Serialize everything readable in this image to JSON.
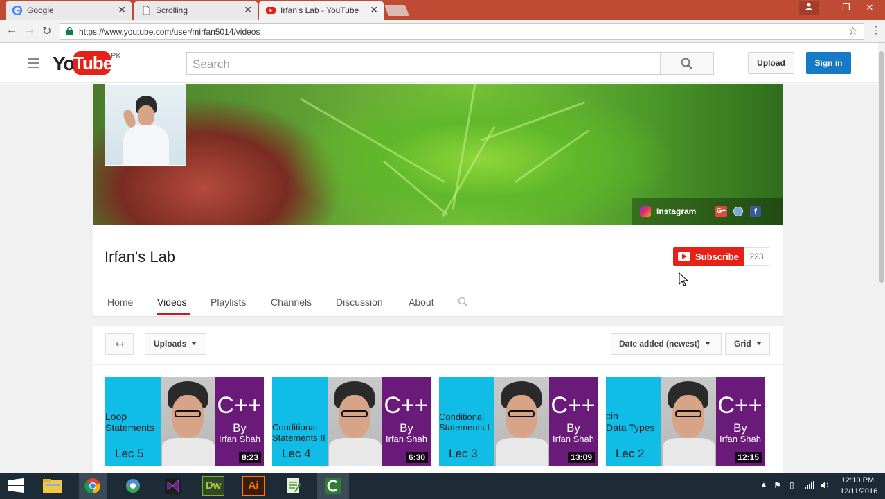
{
  "browser": {
    "tabs": [
      {
        "title": "Google",
        "icon": "google-icon"
      },
      {
        "title": "Scrolling",
        "icon": "page-icon"
      },
      {
        "title": "Irfan's Lab - YouTube",
        "icon": "youtube-icon"
      }
    ],
    "url": "https://www.youtube.com/user/mirfan5014/videos"
  },
  "yt_header": {
    "logo_you": "You",
    "logo_tube": "Tube",
    "region": "PK",
    "search_placeholder": "Search",
    "upload_label": "Upload",
    "signin_label": "Sign in"
  },
  "banner": {
    "links": {
      "instagram_label": "Instagram",
      "gplus_label": "G+",
      "facebook_label": "f"
    }
  },
  "channel": {
    "name": "Irfan's Lab",
    "subscribe_label": "Subscribe",
    "subscriber_count": "223",
    "tabs": [
      "Home",
      "Videos",
      "Playlists",
      "Channels",
      "Discussion",
      "About"
    ],
    "active_tab": "Videos"
  },
  "videos_toolbar": {
    "back_arrow": "↤",
    "uploads_label": "Uploads",
    "sort_label": "Date added (newest)",
    "view_label": "Grid"
  },
  "videos": [
    {
      "topic_line1": "Loop",
      "topic_line2": "Statements",
      "lecture": "Lec 5",
      "language": "C++",
      "by": "By",
      "author": "Irfan Shah",
      "duration": "8:23"
    },
    {
      "topic_line1": "Conditional",
      "topic_line2": "Statements II",
      "lecture": "Lec 4",
      "language": "C++",
      "by": "By",
      "author": "Irfan Shah",
      "duration": "6:30"
    },
    {
      "topic_line1": "Conditional",
      "topic_line2": "Statements I",
      "lecture": "Lec 3",
      "language": "C++",
      "by": "By",
      "author": "Irfan Shah",
      "duration": "13:09"
    },
    {
      "topic_line1": "cin",
      "topic_line2": "Data Types",
      "lecture": "Lec 2",
      "language": "C++",
      "by": "By",
      "author": "Irfan Shah",
      "duration": "12:15"
    }
  ],
  "taskbar": {
    "time": "12:10 PM",
    "date": "12/11/2016",
    "apps": [
      "file-explorer-icon",
      "chrome-icon",
      "browser-icon",
      "visual-studio-icon",
      "dreamweaver-icon",
      "illustrator-icon",
      "notepad-icon",
      "camtasia-icon"
    ],
    "dw_label": "Dw",
    "ai_label": "Ai"
  },
  "colors": {
    "tabstrip": "#c04b35",
    "youtube_red": "#e62117",
    "signin_blue": "#167ac6",
    "thumb_cyan": "#10bde6",
    "thumb_purple": "#6a1b7a"
  }
}
